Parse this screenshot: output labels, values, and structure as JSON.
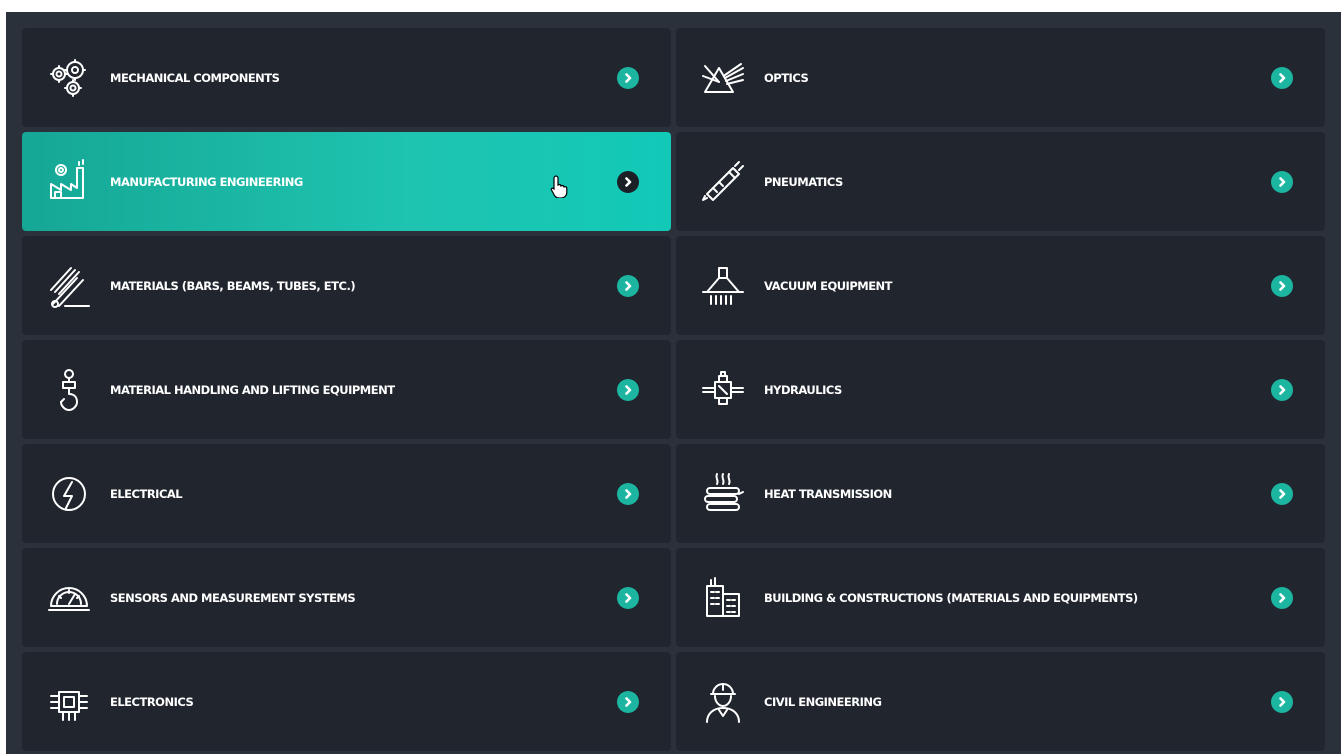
{
  "categories": [
    {
      "label": "MECHANICAL COMPONENTS",
      "icon": "gears-icon"
    },
    {
      "label": "OPTICS",
      "icon": "prism-icon"
    },
    {
      "label": "MANUFACTURING ENGINEERING",
      "icon": "factory-gear-icon",
      "active": true
    },
    {
      "label": "PNEUMATICS",
      "icon": "pneumatic-cylinder-icon"
    },
    {
      "label": "MATERIALS (BARS, BEAMS, TUBES, ETC.)",
      "icon": "bars-tubes-icon"
    },
    {
      "label": "VACUUM EQUIPMENT",
      "icon": "vacuum-hood-icon"
    },
    {
      "label": "MATERIAL HANDLING AND LIFTING EQUIPMENT",
      "icon": "crane-hook-icon"
    },
    {
      "label": "HYDRAULICS",
      "icon": "hydraulic-valve-icon"
    },
    {
      "label": "ELECTRICAL",
      "icon": "lightning-icon"
    },
    {
      "label": "HEAT TRANSMISSION",
      "icon": "heat-pipes-icon"
    },
    {
      "label": "SENSORS AND MEASUREMENT SYSTEMS",
      "icon": "gauge-icon"
    },
    {
      "label": "BUILDING & CONSTRUCTIONS (MATERIALS AND EQUIPMENTS)",
      "icon": "buildings-icon"
    },
    {
      "label": "ELECTRONICS",
      "icon": "chip-icon"
    },
    {
      "label": "CIVIL ENGINEERING",
      "icon": "engineer-helmet-icon"
    }
  ],
  "colors": {
    "background": "#2b313b",
    "tile": "#20252e",
    "accent": "#1cb6a0",
    "active_gradient_start": "#16a795",
    "active_gradient_end": "#12c9b8"
  },
  "arrow_icon": "chevron-right-icon",
  "cursor_icon": "hand-pointer-icon"
}
